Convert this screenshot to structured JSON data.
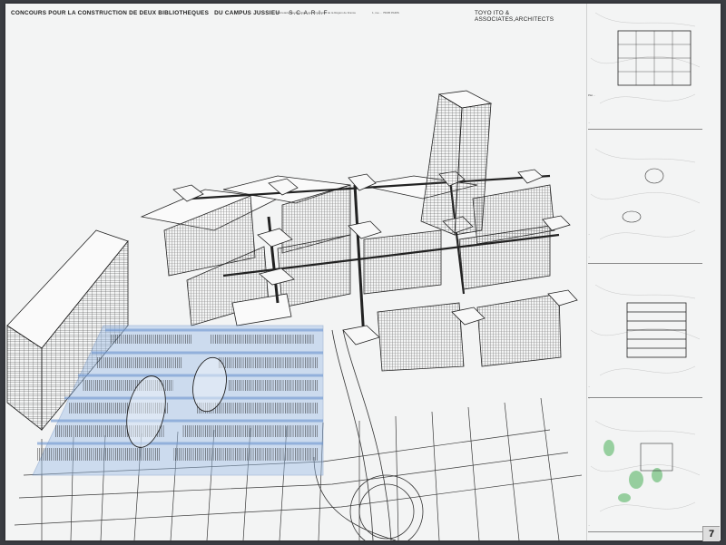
{
  "header": {
    "title": "CONCOURS POUR LA CONSTRUCTION DE DEUX BIBLIOTHEQUES",
    "campus": "DU CAMPUS JUSSIEU",
    "org": "S.C.A.R.I.F",
    "subtitle_1": "Sécretariat  Constructions des  Universités de la Région de France",
    "subtitle_2": "1, rue ...  75005 PARIS",
    "architect": "TOYO ITO & ASSOCIATES,ARCHITECTS"
  },
  "sidebar": {
    "panels": [
      {
        "caption_top": "",
        "caption_bottom": "Plan ..."
      },
      {
        "caption_top": "...",
        "caption_bottom": "..."
      },
      {
        "caption_top": "...",
        "caption_bottom": "..."
      },
      {
        "caption_top": "...",
        "caption_bottom": "..."
      }
    ]
  },
  "page_number": "7",
  "colors": {
    "board": "#f3f4f4",
    "library_blue": "#9dbfe8",
    "line": "#2a2a2a",
    "garden_green": "#6fbf7a",
    "frame": "#3b3d42"
  }
}
